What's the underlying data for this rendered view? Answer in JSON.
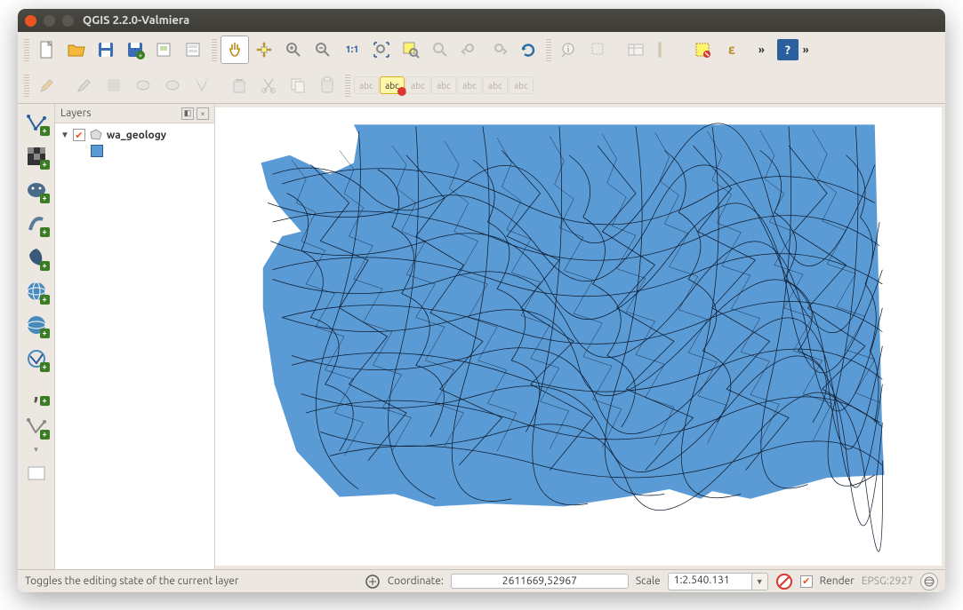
{
  "window": {
    "title": "QGIS 2.2.0-Valmiera"
  },
  "toolbar1": {
    "items": [
      {
        "name": "new-project-icon",
        "glyph": "📄"
      },
      {
        "name": "open-project-icon",
        "glyph": "📂"
      },
      {
        "name": "save-project-icon",
        "glyph": "💾"
      },
      {
        "name": "save-as-icon",
        "glyph": "💾"
      },
      {
        "name": "new-print-composer-icon",
        "glyph": "▭"
      },
      {
        "name": "composer-manager-icon",
        "glyph": "▭"
      }
    ],
    "nav": [
      {
        "name": "pan-icon",
        "glyph": "✋"
      },
      {
        "name": "pan-to-selection-icon",
        "glyph": "✥"
      },
      {
        "name": "zoom-in-icon",
        "glyph": "🔍"
      },
      {
        "name": "zoom-out-icon",
        "glyph": "🔍"
      },
      {
        "name": "zoom-native-icon",
        "glyph": "1:1"
      },
      {
        "name": "zoom-full-icon",
        "glyph": "⛶"
      },
      {
        "name": "zoom-selection-icon",
        "glyph": "🔍"
      },
      {
        "name": "zoom-layer-icon",
        "glyph": "🔍"
      },
      {
        "name": "zoom-last-icon",
        "glyph": "↶"
      },
      {
        "name": "zoom-next-icon",
        "glyph": "↷"
      },
      {
        "name": "refresh-icon",
        "glyph": "⟳"
      }
    ],
    "info": [
      {
        "name": "identify-icon",
        "glyph": "ℹ"
      },
      {
        "name": "select-icon",
        "glyph": "▭"
      },
      {
        "name": "deselect-icon",
        "glyph": "▭"
      },
      {
        "name": "measure-icon",
        "glyph": "📏"
      },
      {
        "name": "tips-icon",
        "glyph": "💡"
      },
      {
        "name": "expression-icon",
        "glyph": "ε"
      }
    ]
  },
  "toolbar2": {
    "items": [
      {
        "name": "toggle-editing-icon",
        "glyph": "✎"
      },
      {
        "name": "edits-icon",
        "glyph": "✎"
      },
      {
        "name": "save-edits-icon",
        "glyph": "💾"
      },
      {
        "name": "add-feature-icon",
        "glyph": "⬭"
      },
      {
        "name": "move-feature-icon",
        "glyph": "⬭"
      },
      {
        "name": "node-tool-icon",
        "glyph": "✂"
      },
      {
        "name": "delete-icon",
        "glyph": "🗑"
      },
      {
        "name": "cut-icon",
        "glyph": "✂"
      },
      {
        "name": "copy-icon",
        "glyph": "📋"
      },
      {
        "name": "paste-icon",
        "glyph": "📋"
      }
    ],
    "labels": [
      {
        "name": "label-abc-icon",
        "glyph": "abc"
      },
      {
        "name": "label-highlight-icon",
        "glyph": "abc",
        "hl": true
      },
      {
        "name": "label-pin-icon",
        "glyph": "abc"
      },
      {
        "name": "label-show-icon",
        "glyph": "abc"
      },
      {
        "name": "label-move-icon",
        "glyph": "abc"
      },
      {
        "name": "label-rotate-icon",
        "glyph": "abc"
      },
      {
        "name": "label-change-icon",
        "glyph": "abc"
      }
    ]
  },
  "left_toolbar": [
    {
      "name": "add-vector-icon",
      "glyph": "V"
    },
    {
      "name": "add-raster-icon",
      "glyph": "▦"
    },
    {
      "name": "add-postgis-icon",
      "glyph": "🐘"
    },
    {
      "name": "add-spatialite-icon",
      "glyph": "🪶"
    },
    {
      "name": "add-mssql-icon",
      "glyph": "◐"
    },
    {
      "name": "add-wms-icon",
      "glyph": "🌐"
    },
    {
      "name": "add-wcs-icon",
      "glyph": "🌐"
    },
    {
      "name": "add-wfs-icon",
      "glyph": "V"
    },
    {
      "name": "add-csv-icon",
      "glyph": "，"
    },
    {
      "name": "new-shapefile-icon",
      "glyph": "V"
    },
    {
      "name": "remove-icon",
      "glyph": "▭"
    }
  ],
  "layers_panel": {
    "title": "Layers",
    "layer_name": "wa_geology"
  },
  "statusbar": {
    "hint": "Toggles the editing state of the current layer",
    "coord_label": "Coordinate:",
    "coord_value": "2611669,52967",
    "scale_label": "Scale",
    "scale_value": "1:2.540.131",
    "render_label": "Render",
    "epsg": "EPSG:2927"
  }
}
